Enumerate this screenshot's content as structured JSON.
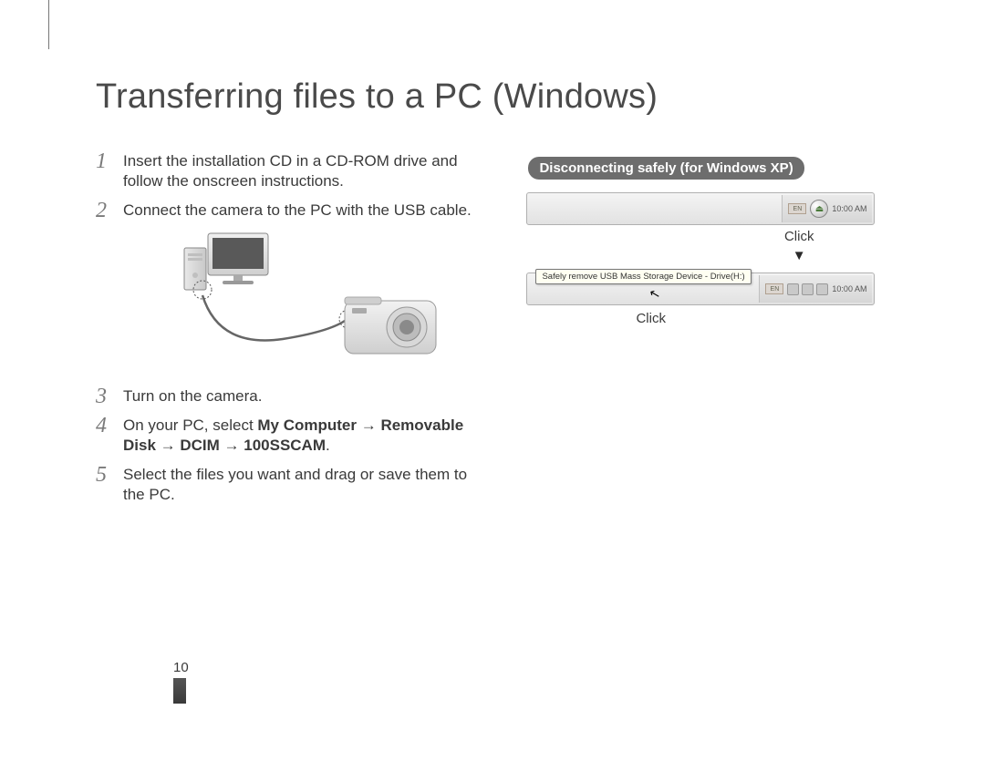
{
  "heading": "Transferring files to a PC (Windows)",
  "steps": {
    "s1": {
      "num": "1",
      "text": "Insert the installation CD in a CD-ROM drive and follow the onscreen instructions."
    },
    "s2": {
      "num": "2",
      "text": "Connect the camera to the PC with the USB cable."
    },
    "s3": {
      "num": "3",
      "text": "Turn on the camera."
    },
    "s4": {
      "num": "4",
      "prefix": "On your PC, select ",
      "bold": "My Computer → Removable Disk → DCIM → 100SSCAM",
      "suffix": "."
    },
    "s5": {
      "num": "5",
      "text": "Select the files you want and drag or save them to the PC."
    }
  },
  "sidebox": {
    "title": "Disconnecting safely (for Windows XP)",
    "lang_chip": "EN",
    "time": "10:00 AM",
    "click1": "Click",
    "arrow": "▼",
    "balloon": "Safely remove USB Mass Storage Device - Drive(H:)",
    "click2": "Click"
  },
  "page_number": "10"
}
